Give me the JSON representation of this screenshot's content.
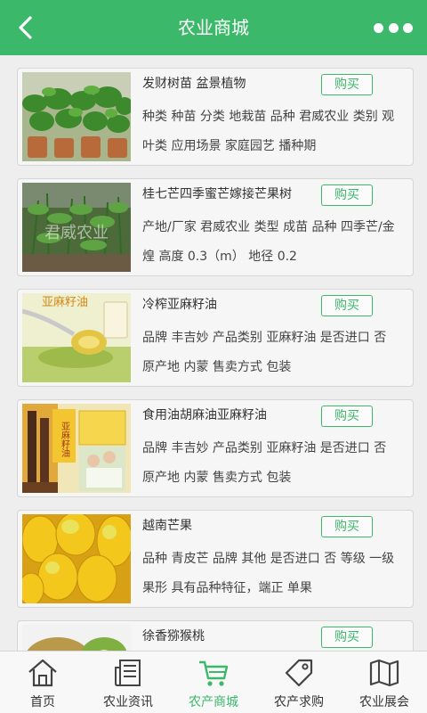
{
  "header": {
    "title": "农业商城",
    "back_icon": "back-arrow-icon",
    "more_icon": "more-dots-icon",
    "color": "#3cb86a"
  },
  "products": [
    {
      "name": "发财树苗 盆景植物",
      "desc": "种类 种苗 分类 地栽苗 品种 君威农业 类别 观叶类 应用场景 家庭园艺 播种期",
      "buy": "购买",
      "image": "potted-seedlings"
    },
    {
      "name": "桂七芒四季蜜芒嫁接芒果树",
      "desc": "产地/厂家 君威农业 类型 成苗 品种 四季芒/金煌 高度 0.3（m） 地径 0.2",
      "buy": "购买",
      "image": "mango-saplings",
      "image_text": "君威农业"
    },
    {
      "name": "冷榨亚麻籽油",
      "desc": "品牌 丰吉妙 产品类别 亚麻籽油 是否进口 否 原产地 内蒙 售卖方式 包装",
      "buy": "购买",
      "image": "linseed-oil",
      "image_text": "亚麻籽油"
    },
    {
      "name": "食用油胡麻油亚麻籽油",
      "desc": "品牌 丰吉妙 产品类别 亚麻籽油 是否进口 否 原产地 内蒙 售卖方式 包装",
      "buy": "购买",
      "image": "flax-oil-boxes",
      "image_text": "亚麻籽油"
    },
    {
      "name": "越南芒果",
      "desc": "品种 青皮芒 品牌 其他 是否进口 否 等级 一级 果形 具有品种特征，端正 单果",
      "buy": "购买",
      "image": "mangoes"
    },
    {
      "name": "徐香猕猴桃",
      "desc": "",
      "buy": "购买",
      "image": "kiwi"
    }
  ],
  "tabs": [
    {
      "label": "首页",
      "icon": "home-icon",
      "active": false
    },
    {
      "label": "农业资讯",
      "icon": "news-icon",
      "active": false
    },
    {
      "label": "农产商城",
      "icon": "cart-icon",
      "active": true
    },
    {
      "label": "农产求购",
      "icon": "tag-icon",
      "active": false
    },
    {
      "label": "农业展会",
      "icon": "map-icon",
      "active": false
    }
  ]
}
